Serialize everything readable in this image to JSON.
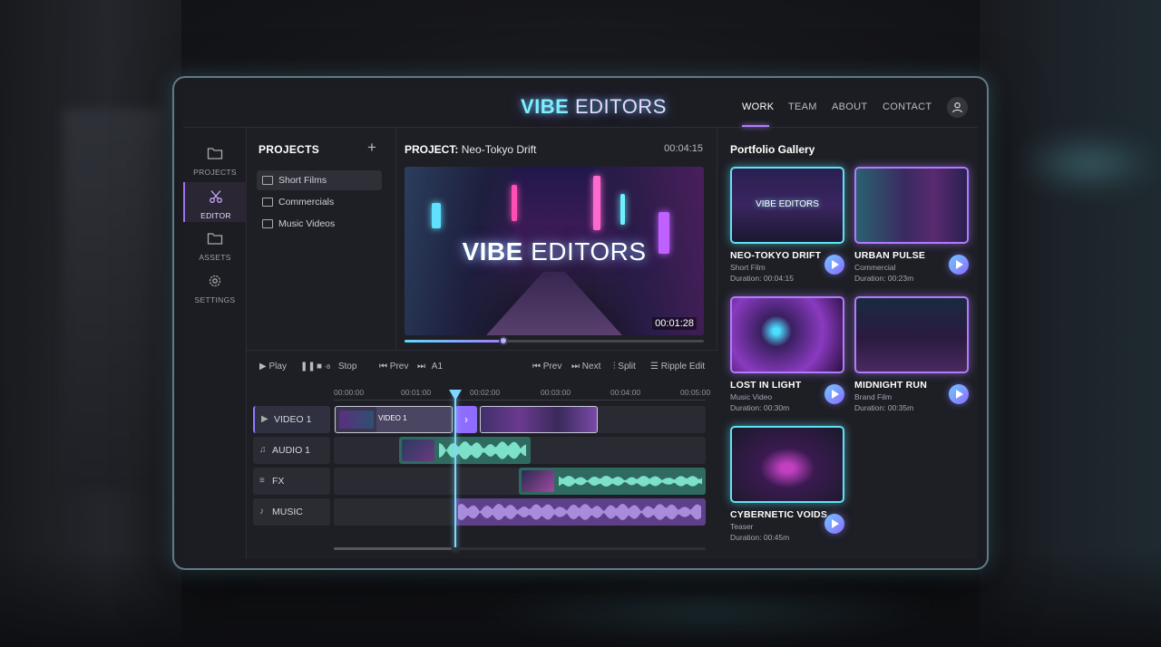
{
  "brand": {
    "bold": "VIBE",
    "light": "EDITORS"
  },
  "nav": [
    {
      "label": "WORK",
      "active": true
    },
    {
      "label": "TEAM",
      "active": false
    },
    {
      "label": "ABOUT",
      "active": false
    },
    {
      "label": "CONTACT",
      "active": false
    }
  ],
  "rail": [
    {
      "label": "PROJECTS",
      "icon": "folder-icon"
    },
    {
      "label": "EDITOR",
      "icon": "scissors-icon",
      "active": true
    },
    {
      "label": "ASSETS",
      "icon": "folder-icon"
    },
    {
      "label": "SETTINGS",
      "icon": "gear-icon"
    }
  ],
  "projects": {
    "title": "PROJECTS",
    "add": "+",
    "items": [
      "Short Films",
      "Commercials",
      "Music Videos"
    ]
  },
  "preview": {
    "label": "PROJECT:",
    "name": "Neo-Tokyo Drift",
    "duration": "00:04:15",
    "overlay_bold": "VIBE",
    "overlay_light": "EDITORS",
    "timestamp": "00:01:28",
    "progress": 0.33
  },
  "toolbar": {
    "play": "Play",
    "stop": "Stop",
    "stop_num": "-8",
    "prev": "Prev",
    "a1": "A1",
    "prev2": "Prev",
    "next": "Next",
    "split": "Split",
    "ripple": "Ripple Edit"
  },
  "ruler": [
    "00:00:00",
    "00:01:00",
    "00:02:00",
    "00:03:00",
    "00:04:00",
    "00:05:00"
  ],
  "tracks": [
    {
      "label": "VIDEO 1",
      "icon": "play-icon"
    },
    {
      "label": "AUDIO 1",
      "icon": "music-note-icon"
    },
    {
      "label": "FX",
      "icon": "sliders-icon"
    },
    {
      "label": "MUSIC",
      "icon": "music-note-icon"
    }
  ],
  "clip_label": "VIDEO 1",
  "gallery": {
    "title": "Portfolio Gallery",
    "thumb_text": "VIBE EDITORS",
    "cards": [
      {
        "title": "NEO-TOKYO DRIFT",
        "type": "Short Film",
        "duration": "Duration: 00:04:15"
      },
      {
        "title": "URBAN PULSE",
        "type": "Commercial",
        "duration": "Duration: 00:23m"
      },
      {
        "title": "LOST IN LIGHT",
        "type": "Music Video",
        "duration": "Duration: 00:30m"
      },
      {
        "title": "MIDNIGHT RUN",
        "type": "Brand Film",
        "duration": "Duration: 00:35m"
      },
      {
        "title": "CYBERNETIC VOIDS",
        "type": "Teaser",
        "duration": "Duration: 00:45m"
      }
    ]
  }
}
